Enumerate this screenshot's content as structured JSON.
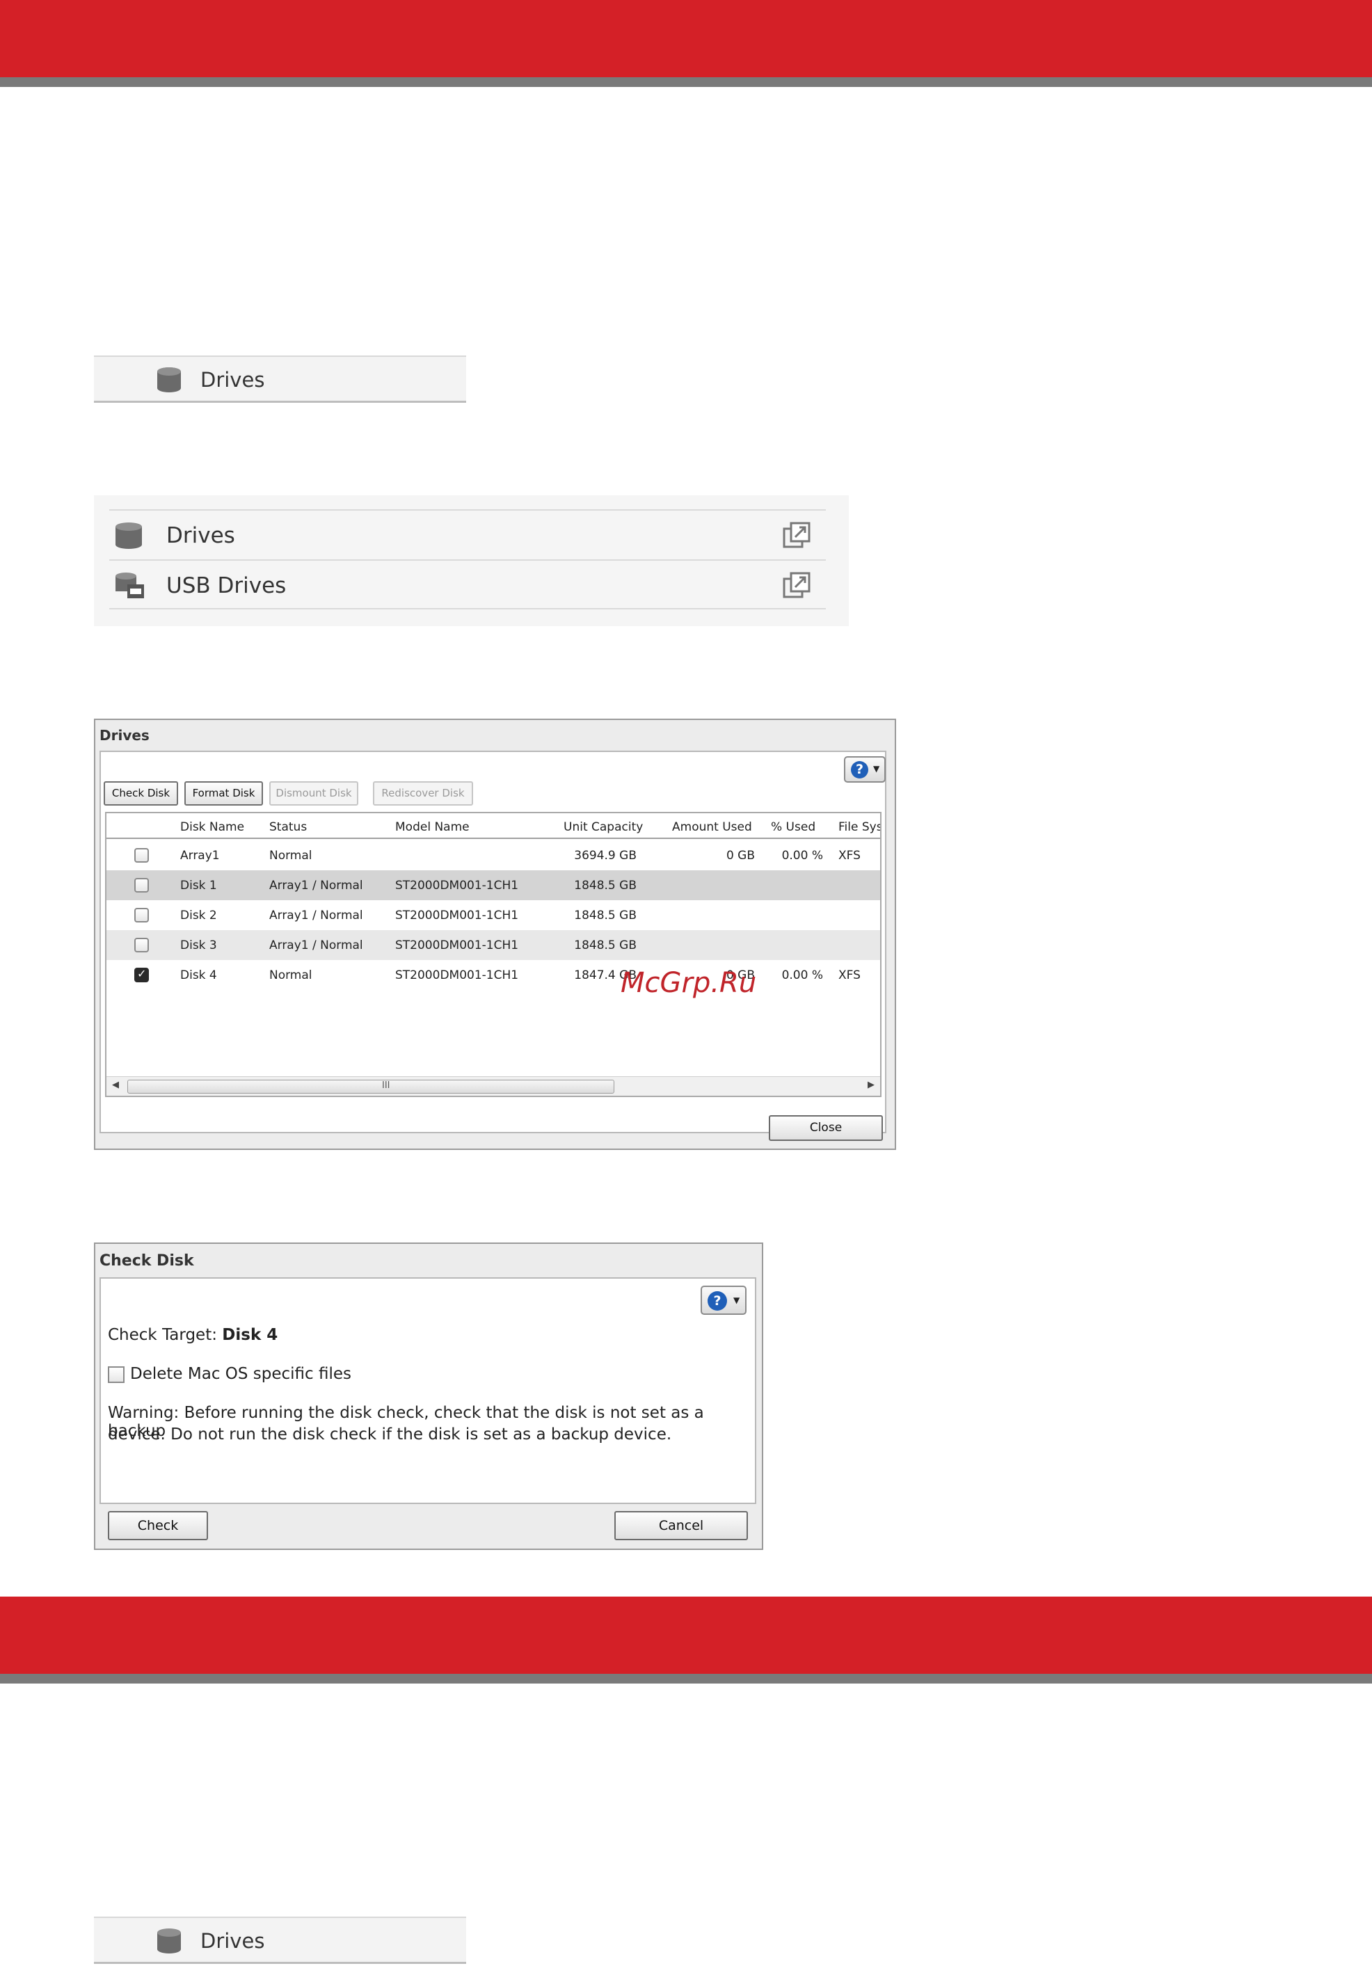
{
  "drives_strip": {
    "label": "Drives"
  },
  "menu_panel": {
    "items": [
      {
        "label": "Drives",
        "icon": "disk-stack-icon",
        "action_icon": "open-window-icon"
      },
      {
        "label": "USB Drives",
        "icon": "usb-drive-icon",
        "action_icon": "open-window-icon"
      }
    ]
  },
  "drives_dialog": {
    "title": "Drives",
    "toolbar": {
      "check_disk": "Check Disk",
      "format_disk": "Format Disk",
      "dismount_disk": "Dismount Disk",
      "rediscover_disk": "Rediscover Disk"
    },
    "columns": [
      "Disk Name",
      "Status",
      "Model Name",
      "Unit Capacity",
      "Amount Used",
      "% Used",
      "File Sys"
    ],
    "rows": [
      {
        "name": "Array1",
        "status": "Normal",
        "model": "",
        "capacity": "3694.9 GB",
        "used": "0 GB",
        "pct": "0.00 %",
        "fs": "XFS",
        "checked": false
      },
      {
        "name": "Disk 1",
        "status": "Array1 / Normal",
        "model": "ST2000DM001-1CH1",
        "capacity": "1848.5 GB",
        "used": "",
        "pct": "",
        "fs": "",
        "checked": false
      },
      {
        "name": "Disk 2",
        "status": "Array1 / Normal",
        "model": "ST2000DM001-1CH1",
        "capacity": "1848.5 GB",
        "used": "",
        "pct": "",
        "fs": "",
        "checked": false
      },
      {
        "name": "Disk 3",
        "status": "Array1 / Normal",
        "model": "ST2000DM001-1CH1",
        "capacity": "1848.5 GB",
        "used": "",
        "pct": "",
        "fs": "",
        "checked": false
      },
      {
        "name": "Disk 4",
        "status": "Normal",
        "model": "ST2000DM001-1CH1",
        "capacity": "1847.4 GB",
        "used": "0 GB",
        "pct": "0.00 %",
        "fs": "XFS",
        "checked": true
      }
    ],
    "scrollbar_grip": "III",
    "close": "Close"
  },
  "check_disk_dialog": {
    "title": "Check Disk",
    "target_label": "Check Target:",
    "target_value": "Disk 4",
    "option_label": "Delete Mac OS specific files",
    "warning_line1": "Warning: Before running the disk check, check that the disk is not set as a backup",
    "warning_line2": "device. Do not run the disk check if the disk is set as a backup device.",
    "check": "Check",
    "cancel": "Cancel"
  },
  "bottom_drives_strip": {
    "label": "Drives"
  },
  "watermark": "McGrp.Ru",
  "colors": {
    "band": "#d42027",
    "band_shadow": "#7a7a7a",
    "help_blue": "#1f5fb8"
  }
}
